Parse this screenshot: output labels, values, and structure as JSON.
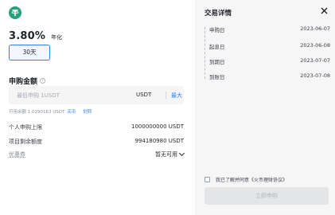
{
  "product": {
    "coin_icon": "tether-icon",
    "rate": "3.80%",
    "rate_unit": "年化",
    "term": "30天"
  },
  "subscribe": {
    "title": "申购金额",
    "info_icon": "info-icon",
    "placeholder": "最低申购 1USDT",
    "currency": "USDT",
    "max_label": "最大",
    "available_text": "可用余额 1.0290163 USDT",
    "buy_link": "买币",
    "transfer_link": "划转"
  },
  "details": [
    {
      "key": "个人申购上限",
      "value": "1000000000 USDT"
    },
    {
      "key": "项目剩余额度",
      "value": "994180980 USDT"
    }
  ],
  "coupon": {
    "key": "优惠券",
    "value": "暂无可用"
  },
  "panel": {
    "title": "交易详情",
    "timeline": [
      {
        "label": "申购日",
        "date": "2023-06-07"
      },
      {
        "label": "起息日",
        "date": "2023-06-08"
      },
      {
        "label": "到期日",
        "date": "2023-07-07"
      },
      {
        "label": "到账日",
        "date": "2023-07-08"
      }
    ],
    "agree_text": "我已了解并同意《火币理财协议》",
    "submit_label": "立即申购"
  },
  "colors": {
    "accent": "#2f7ff0",
    "tether": "#26a17b",
    "panel_bg": "#f6f6f7"
  }
}
